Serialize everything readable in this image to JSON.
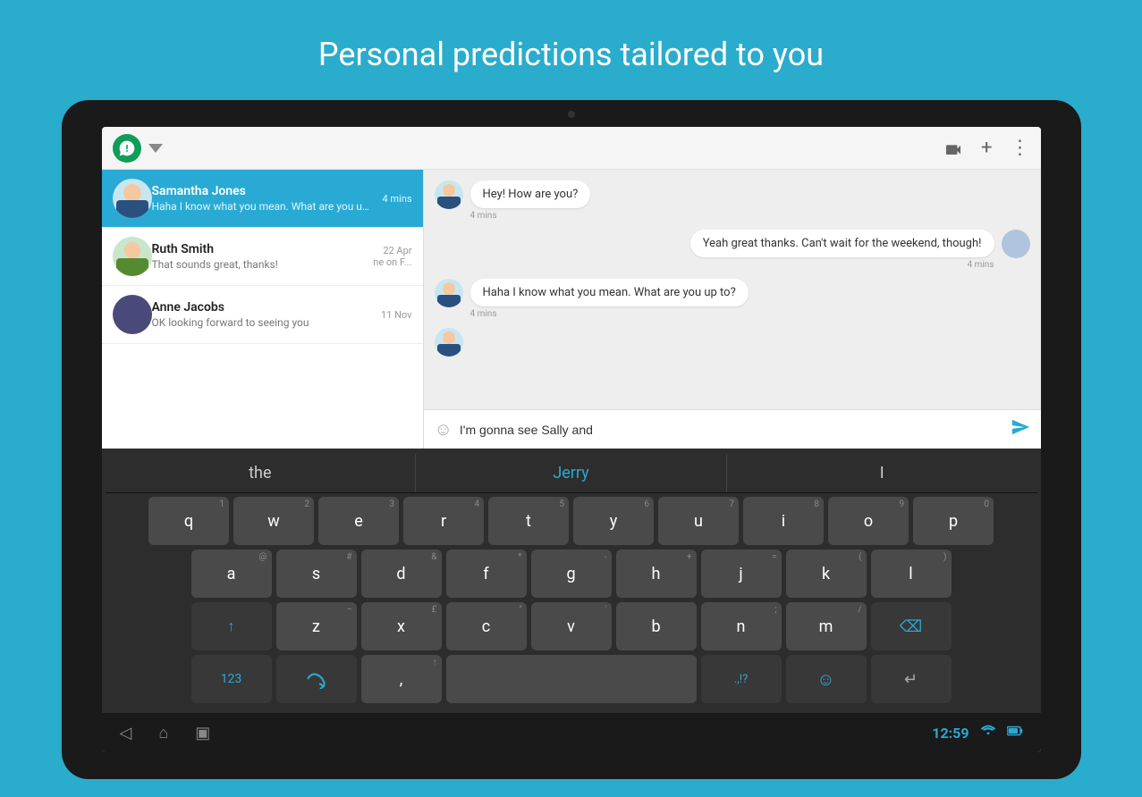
{
  "page": {
    "title": "Personal predictions tailored to you",
    "background_color": "#2aaccc"
  },
  "app_header": {
    "hangouts_icon": "H",
    "video_icon": "🎥",
    "add_icon": "+",
    "more_icon": "⋮"
  },
  "contacts": [
    {
      "name": "Samantha Jones",
      "message": "Haha I know what you mean. What are you up to?",
      "time": "4 mins",
      "active": true
    },
    {
      "name": "Ruth Smith",
      "message": "That sounds great, thanks!",
      "time": "22 Apr",
      "time2": "ne on F...",
      "active": false
    },
    {
      "name": "Anne Jacobs",
      "message": "OK looking forward to seeing you",
      "time": "11 Nov",
      "active": false
    }
  ],
  "messages": [
    {
      "text": "Hey! How are you?",
      "time": "4 mins",
      "outgoing": false
    },
    {
      "text": "Yeah great thanks. Can't wait for the weekend, though!",
      "time": "4 mins",
      "outgoing": true
    },
    {
      "text": "Haha I know what you mean. What are you up to?",
      "time": "4 mins",
      "outgoing": false
    }
  ],
  "chat_input": {
    "value": "I'm gonna see Sally and",
    "placeholder": ""
  },
  "predictions": [
    {
      "text": "the",
      "style": "normal"
    },
    {
      "text": "Jerry",
      "style": "highlighted"
    },
    {
      "text": "I",
      "style": "normal"
    }
  ],
  "keyboard_rows": [
    {
      "keys": [
        {
          "label": "q",
          "num": "1"
        },
        {
          "label": "w",
          "num": "2"
        },
        {
          "label": "e",
          "num": "3"
        },
        {
          "label": "r",
          "num": "4"
        },
        {
          "label": "t",
          "num": "5"
        },
        {
          "label": "y",
          "num": "6"
        },
        {
          "label": "u",
          "num": "7"
        },
        {
          "label": "i",
          "num": "8"
        },
        {
          "label": "o",
          "num": "9"
        },
        {
          "label": "p",
          "num": "0"
        }
      ]
    },
    {
      "keys": [
        {
          "label": "a",
          "sym": "@"
        },
        {
          "label": "s",
          "sym": "#"
        },
        {
          "label": "d",
          "sym": "&"
        },
        {
          "label": "f",
          "sym": "*"
        },
        {
          "label": "g",
          "sym": "-"
        },
        {
          "label": "h",
          "sym": "+"
        },
        {
          "label": "j",
          "sym": "="
        },
        {
          "label": "k",
          "sym": "("
        },
        {
          "label": "l",
          "sym": ")"
        }
      ]
    },
    {
      "keys": [
        {
          "label": "↑",
          "special": true,
          "sym": ""
        },
        {
          "label": "z",
          "sym": "−"
        },
        {
          "label": "x",
          "sym": "£"
        },
        {
          "label": "c",
          "sym": "\""
        },
        {
          "label": "v",
          "sym": "'"
        },
        {
          "label": "b",
          "sym": ""
        },
        {
          "label": "n",
          "sym": ";"
        },
        {
          "label": "m",
          "sym": "/"
        },
        {
          "label": "⌫",
          "special_back": true
        }
      ]
    },
    {
      "keys": [
        {
          "label": "123",
          "special": true
        },
        {
          "label": "🌊",
          "special": true
        },
        {
          "label": ",",
          "sym": ""
        },
        {
          "label": " ",
          "space": true
        },
        {
          "label": ".,!?",
          "special": true
        },
        {
          "label": "😊",
          "special": true
        },
        {
          "label": "↵",
          "special": true
        }
      ]
    }
  ],
  "nav_bar": {
    "back_icon": "◁",
    "home_icon": "⌂",
    "recent_icon": "▣",
    "time": "12:59",
    "wifi_icon": "wifi",
    "battery_icon": "battery"
  }
}
